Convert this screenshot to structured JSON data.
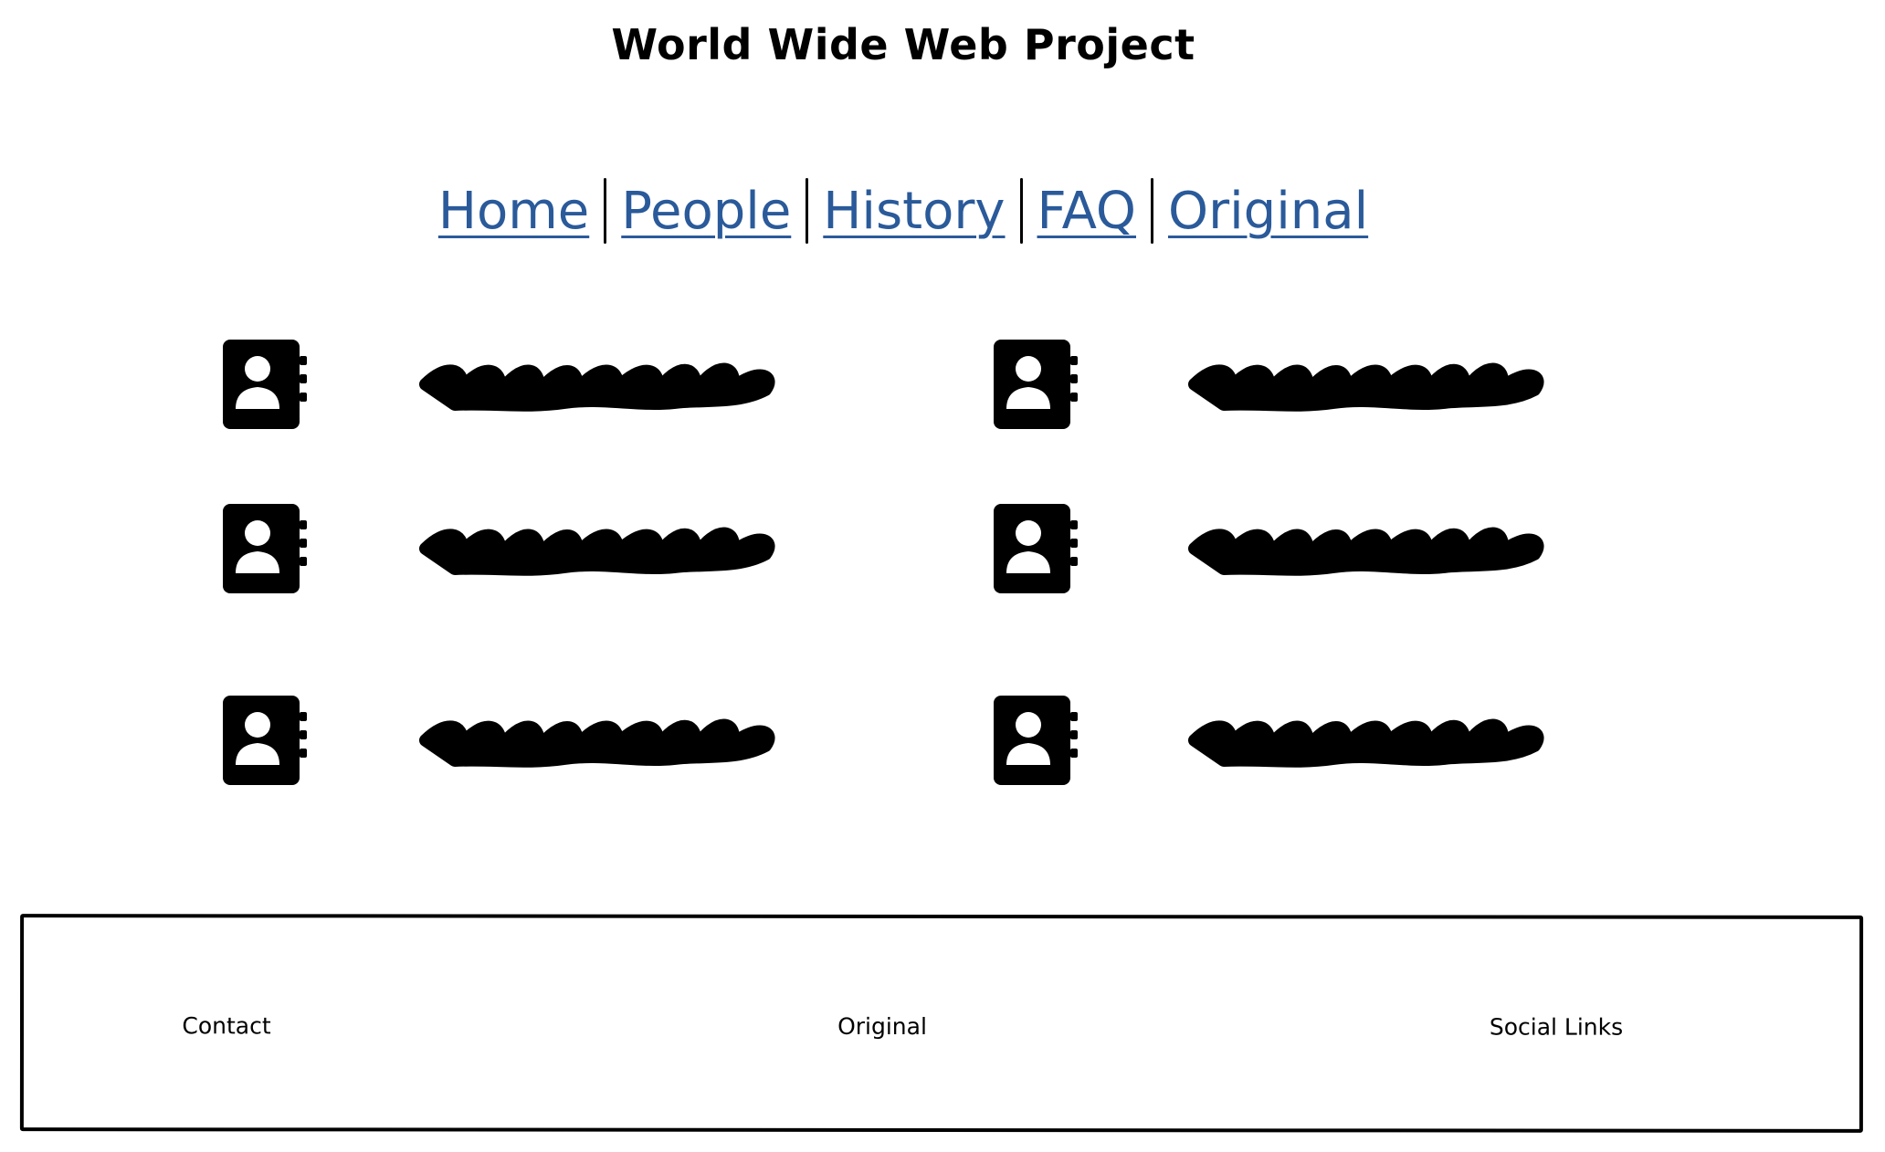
{
  "header": {
    "title": "World Wide Web Project"
  },
  "nav": {
    "links": [
      {
        "label": "Home"
      },
      {
        "label": "People"
      },
      {
        "label": "History"
      },
      {
        "label": "FAQ"
      },
      {
        "label": "Original"
      }
    ]
  },
  "contacts": {
    "icon": "address-book-icon",
    "name_placeholder": "scribble-text-placeholder",
    "count": 6
  },
  "footer": {
    "contact": "Contact",
    "original": "Original",
    "social": "Social Links"
  },
  "colors": {
    "link": "#2a5a9a",
    "ink": "#000000"
  }
}
